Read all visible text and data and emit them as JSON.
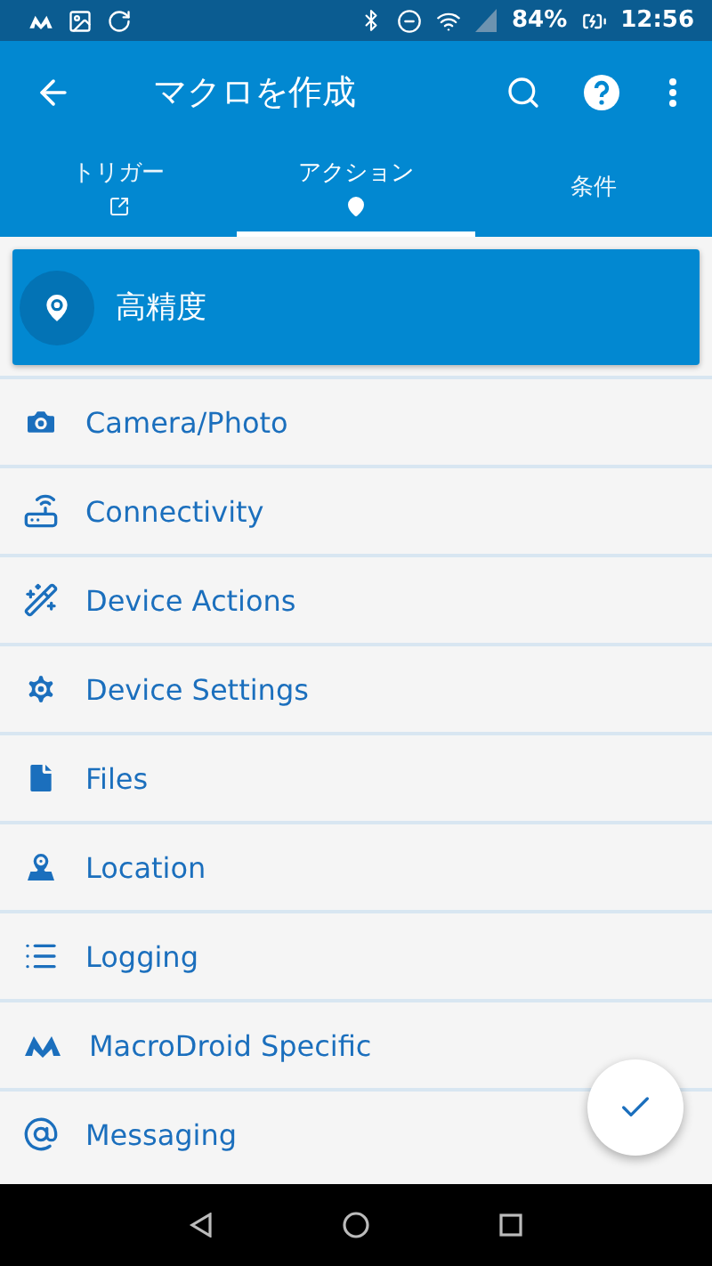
{
  "status_bar": {
    "battery": "84%",
    "time": "12:56"
  },
  "app_bar": {
    "title": "マクロを作成"
  },
  "tabs": [
    {
      "label": "トリガー",
      "selected": false,
      "kind": "icon"
    },
    {
      "label": "アクション",
      "selected": true,
      "kind": "icon"
    },
    {
      "label": "条件",
      "selected": false,
      "kind": "text"
    }
  ],
  "header": {
    "title": "高精度"
  },
  "categories": [
    {
      "label": "Camera/Photo"
    },
    {
      "label": "Connectivity"
    },
    {
      "label": "Device Actions"
    },
    {
      "label": "Device Settings"
    },
    {
      "label": "Files"
    },
    {
      "label": "Location"
    },
    {
      "label": "Logging"
    },
    {
      "label": "MacroDroid Specific"
    },
    {
      "label": "Messaging"
    }
  ]
}
